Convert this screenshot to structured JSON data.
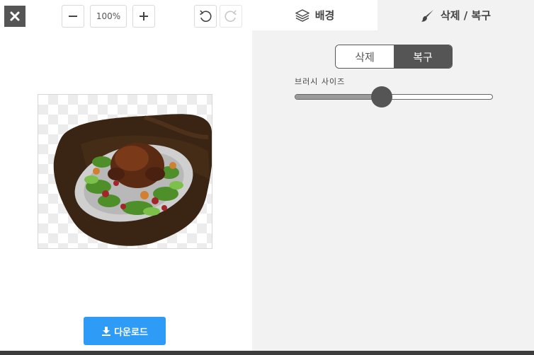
{
  "toolbar": {
    "close_icon": "close-icon",
    "zoom_out_icon": "minus-icon",
    "zoom_level": "100%",
    "zoom_in_icon": "plus-icon",
    "undo_icon": "undo-icon",
    "redo_icon": "redo-icon"
  },
  "tabs": [
    {
      "label": "배경",
      "icon": "layers-icon"
    },
    {
      "label": "삭제 / 복구",
      "icon": "brush-icon"
    }
  ],
  "mode_toggle": {
    "options": [
      "삭제",
      "복구"
    ],
    "selected": "복구"
  },
  "brush": {
    "label": "브러시 사이즈",
    "value_fraction": 0.44
  },
  "download": {
    "label": "다운로드",
    "icon": "download-icon"
  },
  "colors": {
    "accent": "#2e9bf7",
    "dark": "#555555",
    "panel": "#f2f2f2"
  }
}
